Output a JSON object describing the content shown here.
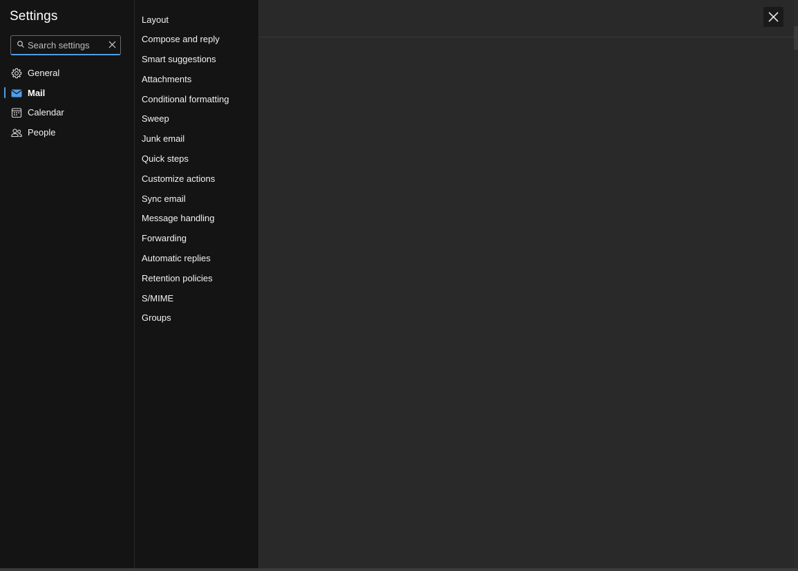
{
  "app": {
    "title": "Settings"
  },
  "search": {
    "placeholder": "Search settings",
    "value": "",
    "icon": "search-icon",
    "clear_icon": "close-icon"
  },
  "nav": {
    "items": [
      {
        "label": "General",
        "icon": "gear-icon",
        "active": false
      },
      {
        "label": "Mail",
        "icon": "mail-icon",
        "active": true
      },
      {
        "label": "Calendar",
        "icon": "calendar-icon",
        "active": false
      },
      {
        "label": "People",
        "icon": "people-icon",
        "active": false
      }
    ]
  },
  "mail_settings": {
    "items": [
      "Layout",
      "Compose and reply",
      "Smart suggestions",
      "Attachments",
      "Conditional formatting",
      "Sweep",
      "Junk email",
      "Quick steps",
      "Customize actions",
      "Sync email",
      "Message handling",
      "Forwarding",
      "Automatic replies",
      "Retention policies",
      "S/MIME",
      "Groups"
    ]
  },
  "header": {
    "close_icon": "close-icon"
  },
  "colors": {
    "accent": "#4f9ee8",
    "nav_bg": "#141414",
    "content_bg": "#292929"
  }
}
